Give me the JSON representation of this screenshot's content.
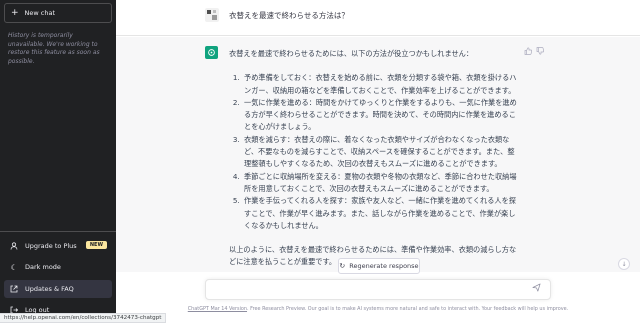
{
  "sidebar": {
    "new_chat_label": "New chat",
    "history_note": "History is temporarily unavailable. We're working to restore this feature as soon as possible.",
    "items": [
      {
        "label": "Upgrade to Plus",
        "icon": "user-icon",
        "badge": "NEW"
      },
      {
        "label": "Dark mode",
        "icon": "moon-icon"
      },
      {
        "label": "Updates & FAQ",
        "icon": "external-link-icon"
      },
      {
        "label": "Log out",
        "icon": "logout-icon"
      }
    ]
  },
  "conversation": {
    "user_message": "衣替えを最速で終わらせる方法は？",
    "assistant": {
      "intro": "衣替えを最速で終わらせるためには、以下の方法が役立つかもしれません：",
      "steps": [
        "予め準備をしておく：衣替えを始める前に、衣類を分類する袋や箱、衣類を掛けるハンガー、収納用の箱などを準備しておくことで、作業効率を上げることができます。",
        "一気に作業を進める：時間をかけてゆっくりと作業をするよりも、一気に作業を進める方が早く終わらせることができます。時間を決めて、その時間内に作業を進めることを心がけましょう。",
        "衣類を減らす：衣替えの際に、着なくなった衣類やサイズが合わなくなった衣類など、不要なものを減らすことで、収納スペースを確保することができます。また、整理整頓もしやすくなるため、次回の衣替えもスムーズに進めることができます。",
        "季節ごとに収納場所を変える：夏物の衣類や冬物の衣類など、季節に合わせた収納場所を用意しておくことで、次回の衣替えもスムーズに進めることができます。",
        "作業を手伝ってくれる人を探す：家族や友人など、一緒に作業を進めてくれる人を探すことで、作業が早く進みます。また、話しながら作業を進めることで、作業が楽しくなるかもしれません。"
      ],
      "outro": "以上のように、衣替えを最速で終わらせるためには、準備や作業効率、衣類の減らし方などに注意を払うことが重要です。"
    }
  },
  "regenerate_label": "Regenerate response",
  "input": {
    "placeholder": ""
  },
  "footer": {
    "version_link": "ChatGPT Mar 14 Version",
    "text": ". Free Research Preview. Our goal is to make AI systems more natural and safe to interact with. Your feedback will help us improve."
  },
  "status_url": "https://help.openai.com/en/collections/3742473-chatgpt",
  "colors": {
    "sidebar": "#202123",
    "accent": "#10a37f",
    "badge": "#fae69e"
  }
}
